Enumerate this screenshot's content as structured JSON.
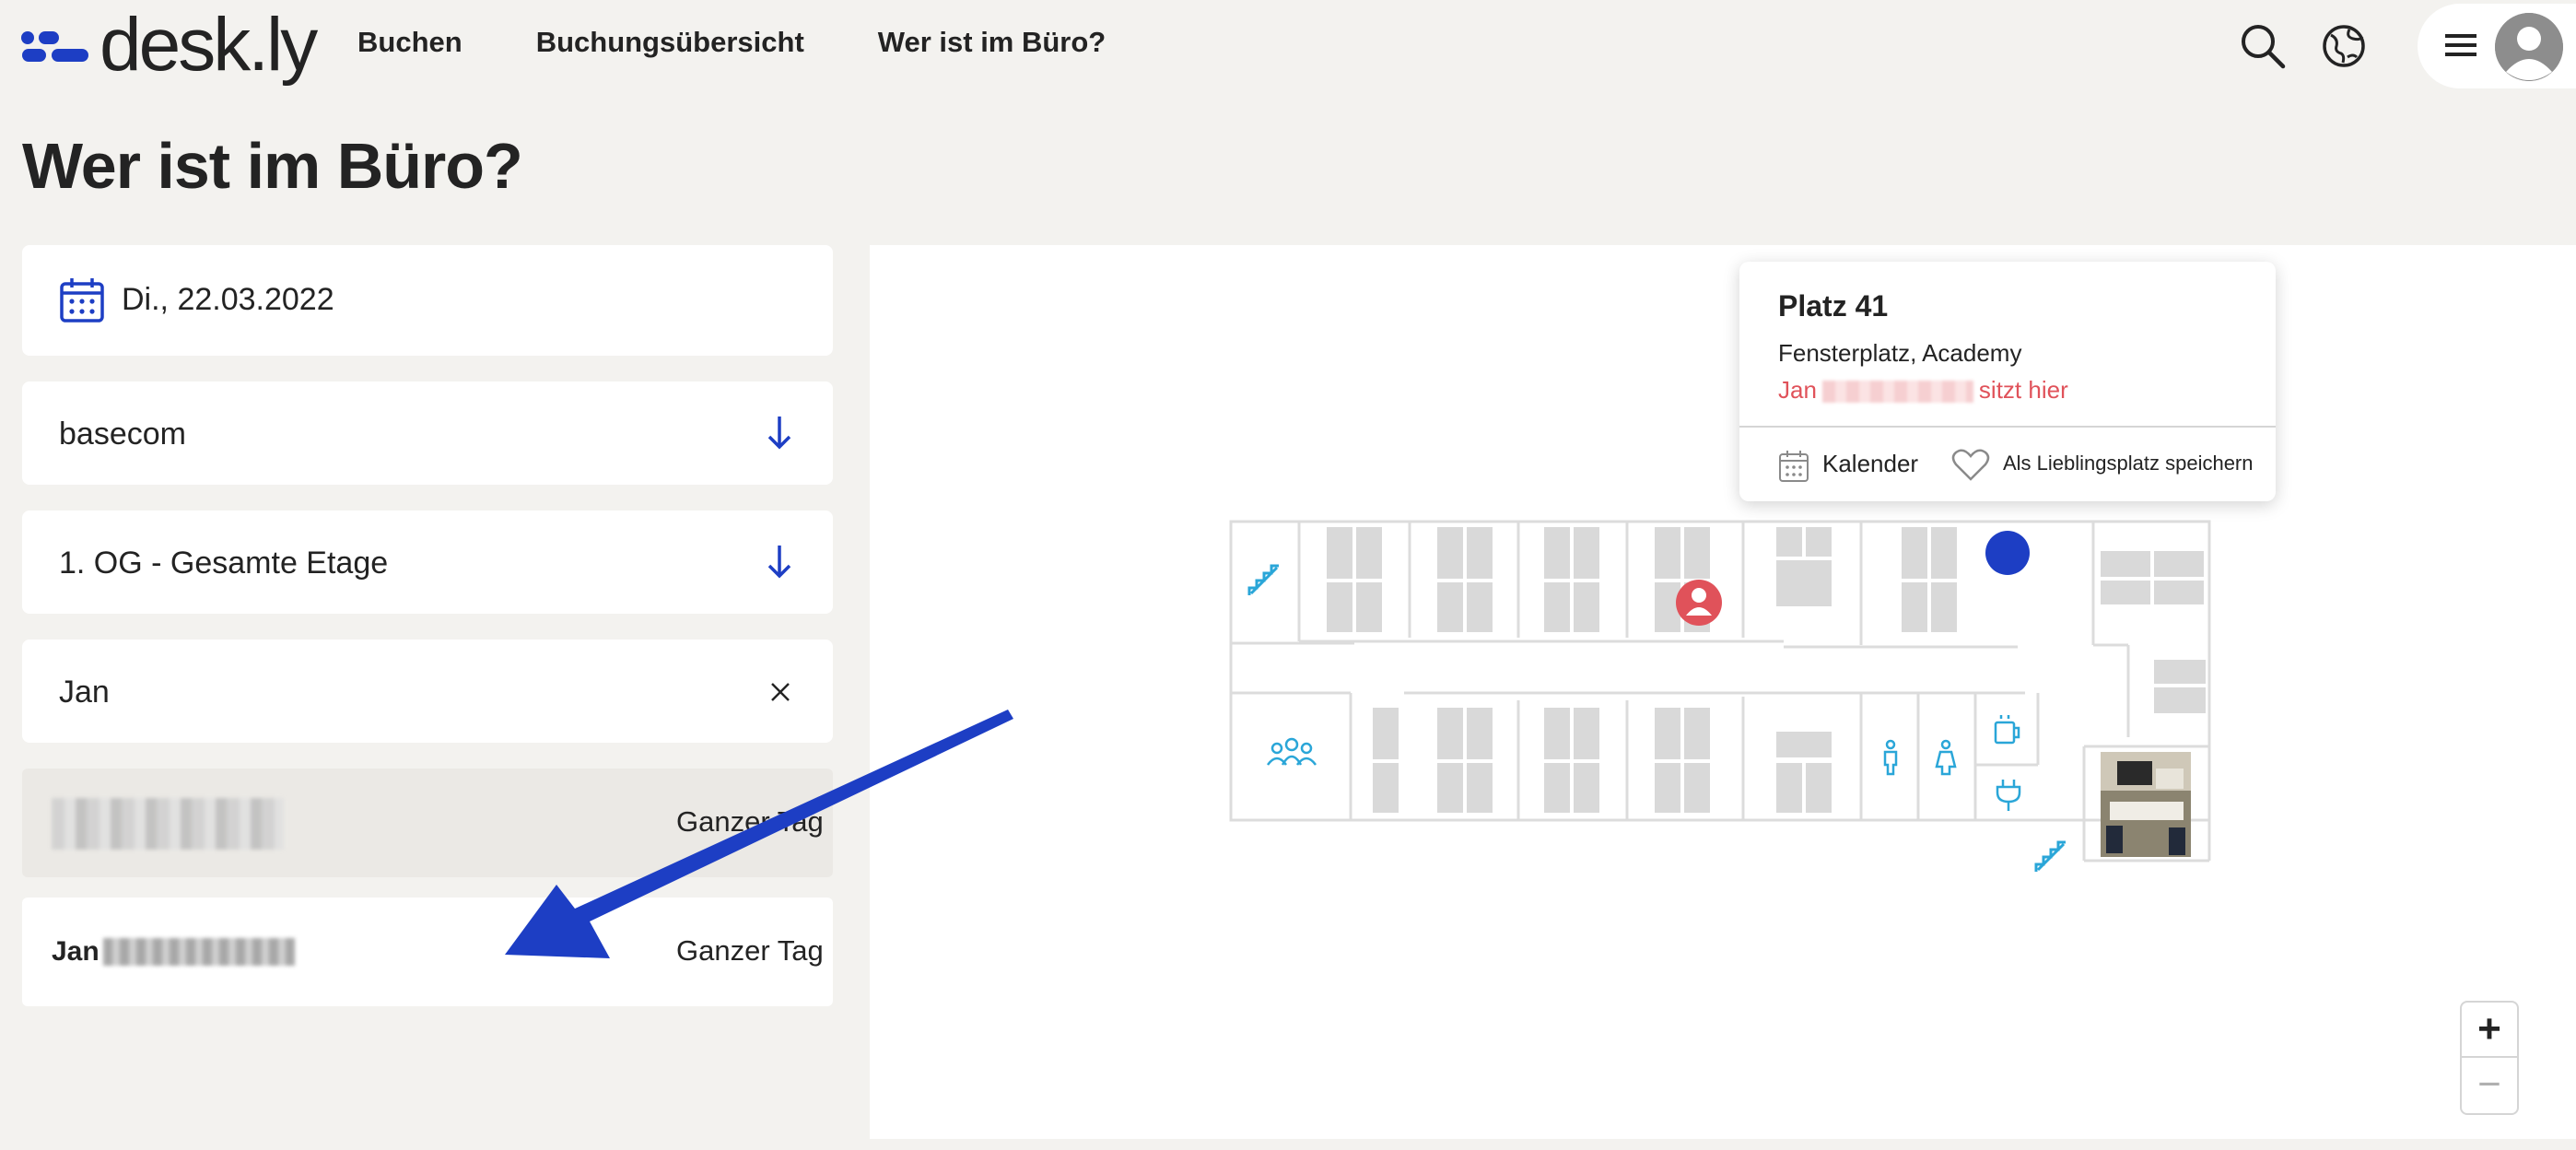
{
  "app": {
    "logo_text": "desk.ly"
  },
  "nav": {
    "items": [
      "Buchen",
      "Buchungsübersicht",
      "Wer ist im Büro?"
    ]
  },
  "page": {
    "title": "Wer ist im Büro?"
  },
  "filters": {
    "date": "Di., 22.03.2022",
    "location": "basecom",
    "floor": "1. OG - Gesamte Etage",
    "search_value": "Jan"
  },
  "results": [
    {
      "name_prefix": "",
      "time": "Ganzer Tag",
      "selected": true
    },
    {
      "name_prefix": "Jan",
      "time": "Ganzer Tag",
      "selected": false
    }
  ],
  "popup": {
    "title": "Platz 41",
    "subtitle": "Fensterplatz, Academy",
    "occupant_prefix": "Jan",
    "occupant_suffix": "sitzt hier",
    "calendar_label": "Kalender",
    "favorite_label": "Als Lieblingsplatz speichern"
  },
  "zoom": {
    "in_label": "+",
    "out_label": "−"
  },
  "colors": {
    "brand": "#1d3ec4",
    "occupied": "#e0525a",
    "map_icon": "#2aa6d8"
  },
  "icons": [
    "logo-icon",
    "search-icon",
    "globe-icon",
    "menu-icon",
    "avatar-icon",
    "calendar-icon",
    "arrow-down-icon",
    "close-icon",
    "heart-icon",
    "stairs-icon",
    "group-icon",
    "male-toilet-icon",
    "female-toilet-icon",
    "coffee-icon",
    "power-plug-icon",
    "person-icon"
  ]
}
